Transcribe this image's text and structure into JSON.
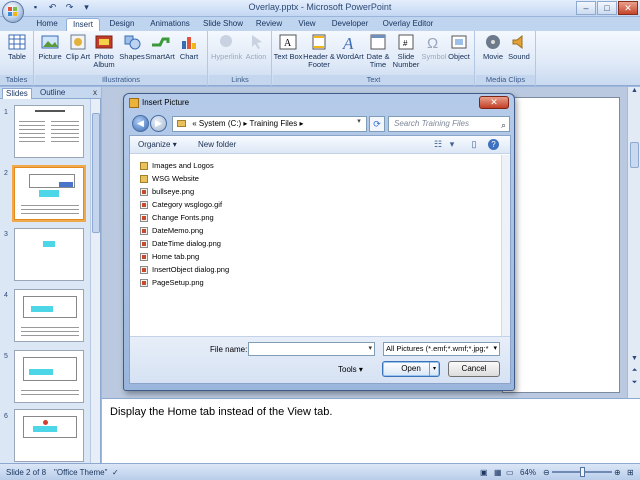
{
  "window": {
    "title": "Overlay.pptx - Microsoft PowerPoint",
    "qat": [
      "save-icon",
      "undo-icon",
      "redo-icon",
      "dropdown-icon"
    ],
    "controls": {
      "minimize": "–",
      "maximize": "□",
      "close": "✕"
    }
  },
  "tabs": [
    "Home",
    "Insert",
    "Design",
    "Animations",
    "Slide Show",
    "Review",
    "View",
    "Developer",
    "Overlay Editor"
  ],
  "active_tab": "Insert",
  "ribbon": {
    "groups": [
      "Tables",
      "Illustrations",
      "Links",
      "Text",
      "Media Clips"
    ],
    "tables": {
      "table": "Table"
    },
    "illustrations": {
      "picture": "Picture",
      "clipart": "Clip Art",
      "photo": "Photo Album",
      "shapes": "Shapes",
      "smartart": "SmartArt",
      "chart": "Chart"
    },
    "links": {
      "hyperlink": "Hyperlink",
      "action": "Action"
    },
    "text": {
      "textbox": "Text Box",
      "header": "Header & Footer",
      "wordart": "WordArt",
      "datetime": "Date & Time",
      "slidenum": "Slide Number",
      "symbol": "Symbol",
      "object": "Object"
    },
    "media": {
      "movie": "Movie",
      "sound": "Sound"
    }
  },
  "left_pane": {
    "tabs": [
      "Slides",
      "Outline"
    ],
    "close": "x",
    "slide_numbers": [
      "1",
      "2",
      "3",
      "4",
      "5",
      "6"
    ]
  },
  "notes": {
    "text": "Display the Home tab instead of the View tab."
  },
  "status": {
    "slide": "Slide 2 of 8",
    "theme": "\"Office Theme\"",
    "zoom": "64%"
  },
  "dialog": {
    "title": "Insert Picture",
    "path": [
      "«",
      "System (C:)",
      "▸",
      "Training Files",
      "▸"
    ],
    "search_placeholder": "Search Training Files",
    "toolbar": {
      "organize": "Organize",
      "new_folder": "New folder"
    },
    "files": [
      {
        "name": "Images and Logos",
        "type": "folder"
      },
      {
        "name": "WSG Website",
        "type": "folder"
      },
      {
        "name": "bullseye.png",
        "type": "image"
      },
      {
        "name": "Category wsglogo.gif",
        "type": "image"
      },
      {
        "name": "Change Fonts.png",
        "type": "image"
      },
      {
        "name": "DateMemo.png",
        "type": "image"
      },
      {
        "name": "DateTime dialog.png",
        "type": "image"
      },
      {
        "name": "Home tab.png",
        "type": "image"
      },
      {
        "name": "InsertObject dialog.png",
        "type": "image"
      },
      {
        "name": "PageSetup.png",
        "type": "image"
      }
    ],
    "file_name_label": "File name:",
    "file_name_value": "",
    "filter": "All Pictures (*.emf;*.wmf;*.jpg;*",
    "tools": "Tools",
    "open": "Open",
    "cancel": "Cancel"
  }
}
